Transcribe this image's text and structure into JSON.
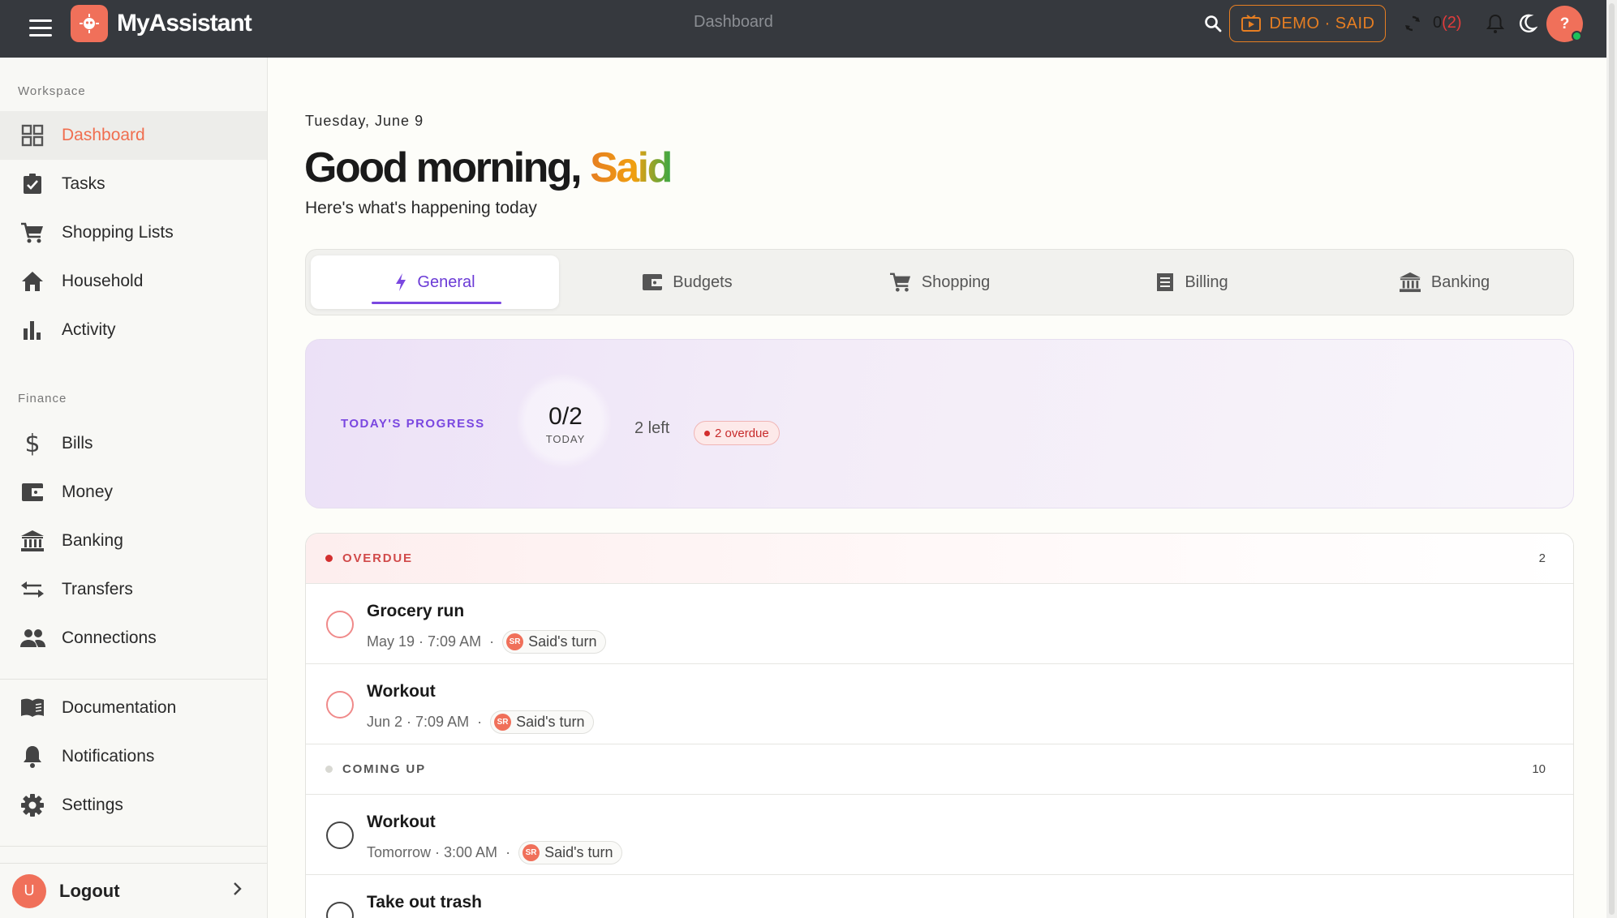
{
  "topbar": {
    "brand": "MyAssistant",
    "center_title": "Dashboard",
    "demo_label": "DEMO · SAID",
    "sync_count": "0",
    "sync_overdue": "(2)",
    "avatar_initial": "?"
  },
  "sidebar": {
    "workspace_label": "Workspace",
    "finance_label": "Finance",
    "workspace_items": [
      {
        "label": "Dashboard",
        "icon": "dashboard-icon"
      },
      {
        "label": "Tasks",
        "icon": "tasks-icon"
      },
      {
        "label": "Shopping Lists",
        "icon": "cart-icon"
      },
      {
        "label": "Household",
        "icon": "home-icon"
      },
      {
        "label": "Activity",
        "icon": "bar-chart-icon"
      }
    ],
    "finance_items": [
      {
        "label": "Bills",
        "icon": "dollar-icon"
      },
      {
        "label": "Money",
        "icon": "wallet-icon"
      },
      {
        "label": "Banking",
        "icon": "bank-icon"
      },
      {
        "label": "Transfers",
        "icon": "transfer-icon"
      },
      {
        "label": "Connections",
        "icon": "people-icon"
      }
    ],
    "other_items": [
      {
        "label": "Documentation",
        "icon": "book-icon"
      },
      {
        "label": "Notifications",
        "icon": "bell-icon"
      },
      {
        "label": "Settings",
        "icon": "gear-icon"
      }
    ],
    "logout_label": "Logout",
    "user_initial": "U"
  },
  "main": {
    "date": "Tuesday, June 9",
    "greeting": "Good morning, ",
    "user_name": "Said",
    "subtitle": "Here's what's happening today",
    "tabs": [
      {
        "label": "General",
        "icon": "bolt-icon"
      },
      {
        "label": "Budgets",
        "icon": "wallet-icon"
      },
      {
        "label": "Shopping",
        "icon": "cart-icon"
      },
      {
        "label": "Billing",
        "icon": "receipt-icon"
      },
      {
        "label": "Banking",
        "icon": "bank-icon"
      }
    ],
    "progress": {
      "label": "TODAY'S PROGRESS",
      "count": "0/2",
      "count_caption": "TODAY",
      "left": "2 left",
      "overdue_badge": "2 overdue"
    },
    "groups": {
      "overdue": {
        "name": "OVERDUE",
        "count": "2"
      },
      "upcoming": {
        "name": "COMING UP",
        "count": "10"
      }
    },
    "overdue_tasks": [
      {
        "title": "Grocery run",
        "when": "May 19 · 7:09 AM",
        "turn": "Said's turn",
        "initials": "SR"
      },
      {
        "title": "Workout",
        "when": "Jun 2 · 7:09 AM",
        "turn": "Said's turn",
        "initials": "SR"
      }
    ],
    "upcoming_tasks": [
      {
        "title": "Workout",
        "when": "Tomorrow · 3:00 AM",
        "turn": "Said's turn",
        "initials": "SR"
      },
      {
        "title": "Take out trash",
        "when": "",
        "turn": "",
        "initials": ""
      }
    ],
    "meta_separator": "·"
  },
  "colors": {
    "accent": "#f06e4f",
    "tab_active": "#6b3bd6",
    "overdue": "#d32f2f",
    "demo": "#e67e22"
  }
}
